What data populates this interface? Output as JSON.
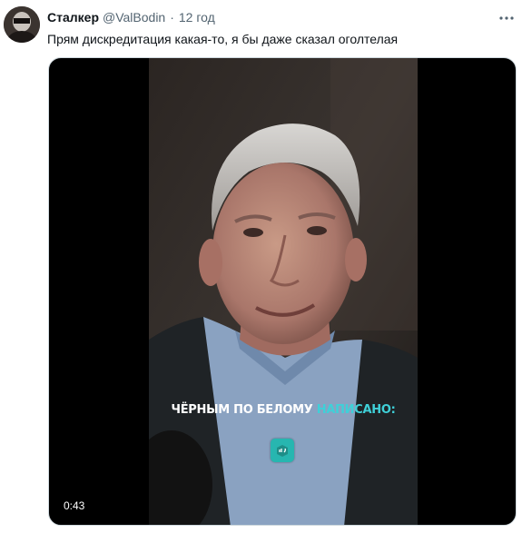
{
  "tweet": {
    "author_name": "Сталкер",
    "author_handle": "@ValBodin",
    "separator": "·",
    "timestamp": "12 год",
    "text": "Прям дискредитация какая-то, я бы даже сказал оголтелая",
    "more_icon": "more-dots-icon",
    "avatar_icon": "avatar"
  },
  "media": {
    "type": "video",
    "caption_white": "ЧЁРНЫМ ПО БЕЛОМУ",
    "caption_accent": "НАПИСАНО:",
    "accent_color": "#3fd0d8",
    "badge_color": "#27b6b0",
    "duration": "0:43"
  }
}
